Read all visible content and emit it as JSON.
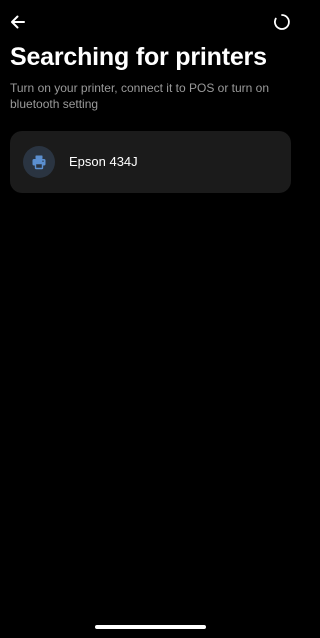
{
  "header": {
    "back_icon": "arrow-left-icon",
    "loading_icon": "spinner-icon"
  },
  "title": "Searching for printers",
  "subtitle": "Turn on your printer, connect it to POS or turn on bluetooth setting",
  "printers": [
    {
      "name": "Epson 434J",
      "icon": "printer-icon"
    }
  ],
  "colors": {
    "background": "#000000",
    "card": "#1b1b1b",
    "icon_circle": "#2a3441",
    "icon_accent": "#5b8fd0",
    "subtitle_text": "#9a9a9a"
  }
}
